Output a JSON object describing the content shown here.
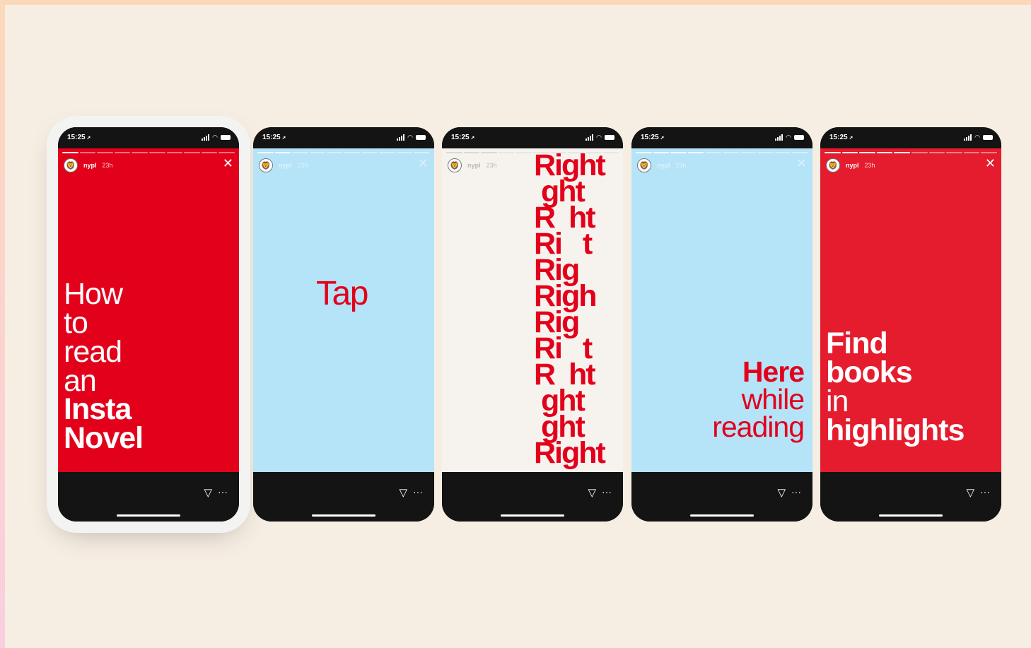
{
  "status": {
    "time": "15:25",
    "arrow": "➚"
  },
  "account": {
    "username": "nypl",
    "age": "23h"
  },
  "icons": {
    "close": "close-icon",
    "send": "send-icon",
    "more": "more-icon",
    "avatar": "lion-logo-icon"
  },
  "colors": {
    "red": "#e3001b",
    "blue": "#b5e3f8",
    "cream": "#f6f3ee"
  },
  "stories": [
    {
      "lines": [
        "How",
        "to",
        "read",
        "an",
        "Insta",
        "Novel"
      ]
    },
    {
      "lines": [
        "Tap"
      ]
    },
    {
      "lines": [
        "Right",
        " ght",
        "R  ht",
        "Ri   t",
        "Rig",
        "Righ",
        "Rig",
        "Ri   t",
        "R  ht",
        " ght",
        " ght",
        "Right"
      ]
    },
    {
      "lines": [
        "Here",
        "while",
        "reading"
      ]
    },
    {
      "lines": [
        "Find",
        "books",
        "in",
        "highlights"
      ]
    }
  ]
}
